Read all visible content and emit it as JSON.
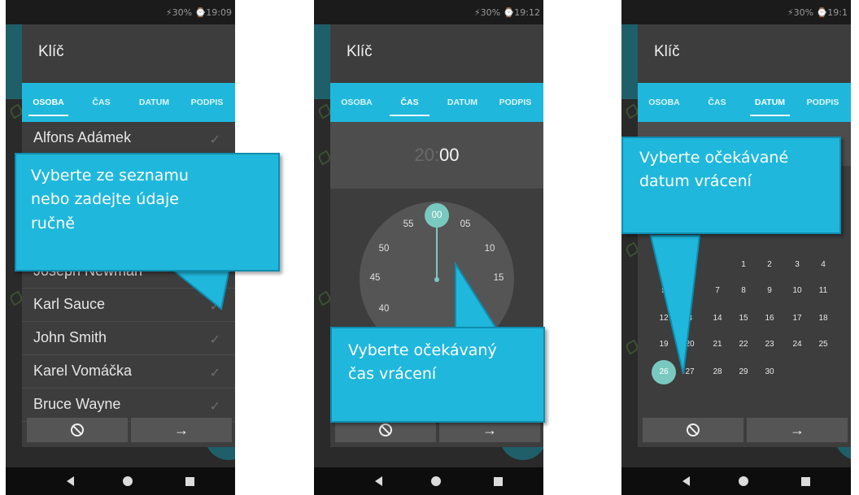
{
  "screens": [
    {
      "status": "⚡30% ⌚19:09",
      "dialog_title": "Klíč",
      "tabs": [
        "OSOBA",
        "ČAS",
        "DATUM",
        "PODPIS"
      ],
      "active_tab": "OSOBA",
      "persons": [
        "Alfons Adámek",
        "Joseph Newman",
        "Karl Sauce",
        "John Smith",
        "Karel Vomáčka",
        "Bruce Wayne"
      ],
      "callout": [
        "Vyberte ze seznamu",
        "nebo zadejte údaje",
        "ručně"
      ]
    },
    {
      "status": "⚡30% ⌚19:12",
      "dialog_title": "Klíč",
      "tabs": [
        "OSOBA",
        "ČAS",
        "DATUM",
        "PODPIS"
      ],
      "active_tab": "ČAS",
      "time_hour": "20:",
      "time_minute": "00",
      "clock_selected": "00",
      "clock_numbers": [
        "05",
        "10",
        "15",
        "40",
        "45",
        "50",
        "55"
      ],
      "callout": [
        "Vyberte očekávaný",
        "čas vrácení"
      ]
    },
    {
      "status": "⚡30% ⌚19:1",
      "dialog_title": "Klíč",
      "tabs": [
        "OSOBA",
        "ČAS",
        "DATUM",
        "PODPIS"
      ],
      "active_tab": "DATUM",
      "calendar_days": [
        "1",
        "2",
        "3",
        "4",
        "5",
        "7",
        "8",
        "9",
        "10",
        "11",
        "12",
        "3",
        "14",
        "15",
        "16",
        "17",
        "18",
        "19",
        "20",
        "21",
        "22",
        "23",
        "24",
        "25",
        "26",
        "27",
        "28",
        "29",
        "30"
      ],
      "selected_day": "26",
      "callout": [
        "Vyberte očekávané",
        "datum vrácení"
      ]
    }
  ],
  "colors": {
    "accent": "#1fb8dc",
    "selected": "#79c9c0",
    "dialog": "#3d3d3d"
  }
}
